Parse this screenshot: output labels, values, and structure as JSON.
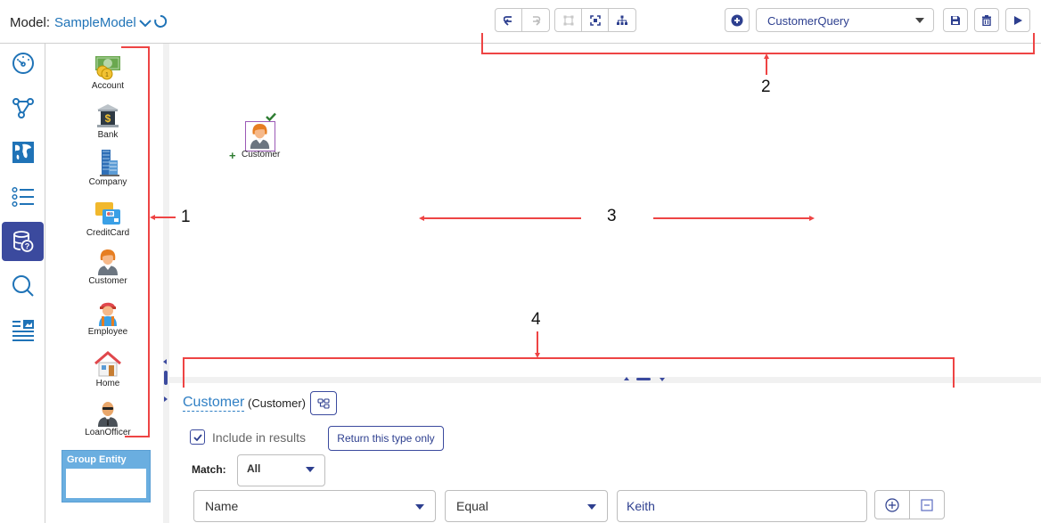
{
  "header": {
    "model_label": "Model:",
    "model_value": "SampleModel",
    "query_select": "CustomerQuery"
  },
  "toolbar": {
    "groups": [
      {
        "name": "history",
        "buttons": [
          "undo-icon",
          "redo-icon"
        ]
      },
      {
        "name": "layout",
        "buttons": [
          "ungroup-icon",
          "fit-screen-icon",
          "hierarchy-layout-icon"
        ]
      }
    ],
    "actions": [
      "add-query-icon",
      "save-icon",
      "delete-icon",
      "run-icon"
    ]
  },
  "sidenav": {
    "items": [
      {
        "icon": "dashboard-icon",
        "active": false
      },
      {
        "icon": "graph-icon",
        "active": false
      },
      {
        "icon": "map-icon",
        "active": false
      },
      {
        "icon": "list-icon",
        "active": false
      },
      {
        "icon": "query-database-icon",
        "active": true
      },
      {
        "icon": "search-icon",
        "active": false
      },
      {
        "icon": "report-icon",
        "active": false
      }
    ]
  },
  "palette": {
    "items": [
      {
        "label": "Account",
        "icon": "money-icon"
      },
      {
        "label": "Bank",
        "icon": "bank-icon"
      },
      {
        "label": "Company",
        "icon": "building-icon"
      },
      {
        "label": "CreditCard",
        "icon": "credit-card-icon"
      },
      {
        "label": "Customer",
        "icon": "customer-icon"
      },
      {
        "label": "Employee",
        "icon": "employee-icon"
      },
      {
        "label": "Home",
        "icon": "house-icon"
      },
      {
        "label": "LoanOfficer",
        "icon": "loan-officer-icon"
      }
    ],
    "group_entity_label": "Group Entity"
  },
  "canvas": {
    "nodes": [
      {
        "label": "Customer",
        "selected": true,
        "included": true
      }
    ]
  },
  "query_panel": {
    "entity_title": "Customer",
    "entity_type": "(Customer)",
    "include_in_results_label": "Include in results",
    "include_in_results_checked": true,
    "return_type_only_label": "Return this type only",
    "match_label": "Match:",
    "match_value": "All",
    "conditions": [
      {
        "field": "Name",
        "operator": "Equal",
        "value": "Keith"
      }
    ]
  },
  "annotations": {
    "callouts": [
      "1",
      "2",
      "3",
      "4"
    ],
    "color": "#ee4444"
  },
  "colors": {
    "accent": "#3b4a9e",
    "link": "#1f73b7",
    "nav_icon": "#1f73b7"
  }
}
